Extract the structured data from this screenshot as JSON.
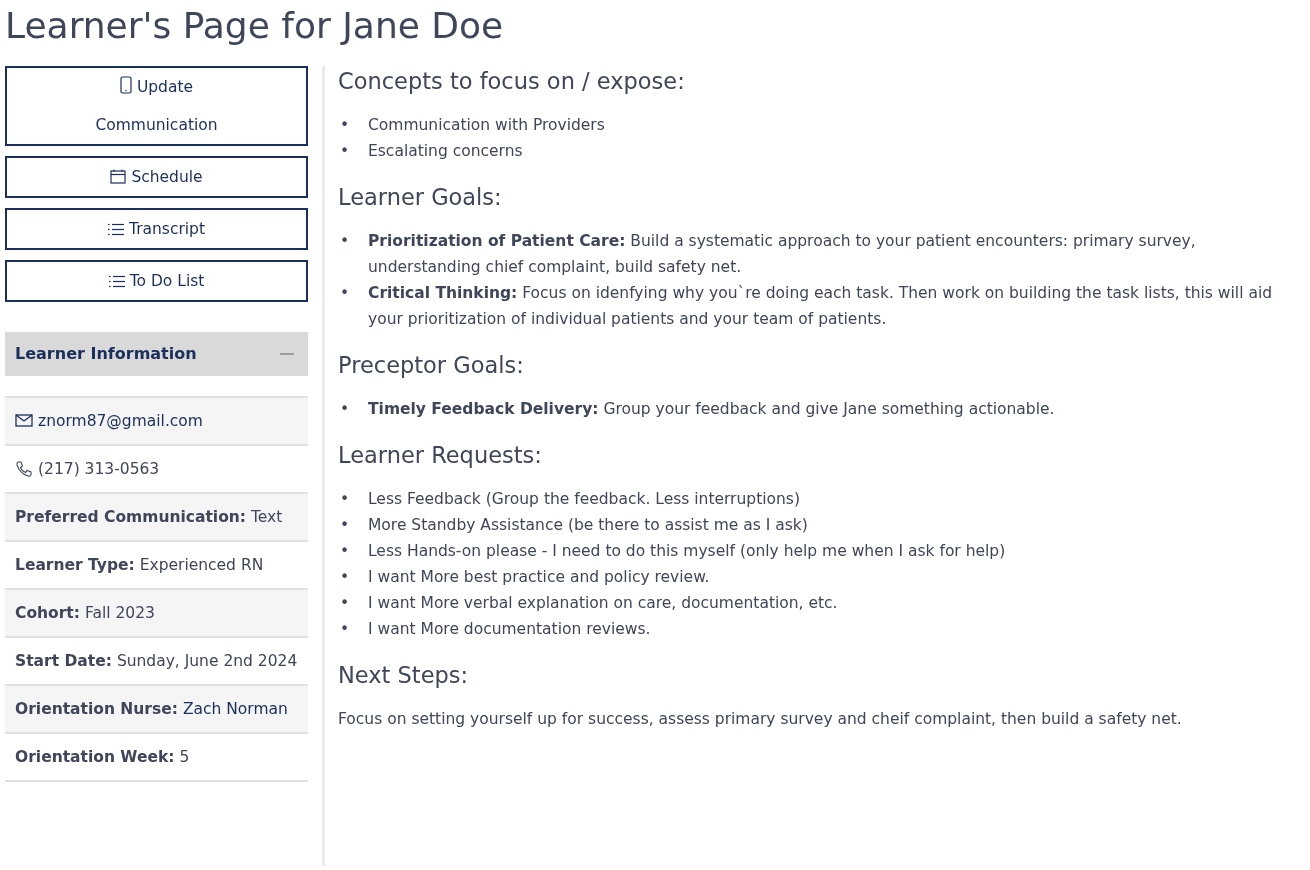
{
  "title": "Learner's Page for Jane Doe",
  "buttons": [
    {
      "label": "Update Communication",
      "kind": "phone"
    },
    {
      "label": "Schedule",
      "kind": "calendar"
    },
    {
      "label": "Transcript",
      "kind": "list"
    },
    {
      "label": "To Do List",
      "kind": "list"
    }
  ],
  "learner_info": {
    "title": "Learner Information",
    "expanded": true,
    "rows": [
      {
        "kind": "email",
        "value": "znorm87@gmail.com"
      },
      {
        "kind": "phone",
        "value": "(217) 313-0563"
      },
      {
        "kind": "field",
        "label": "Preferred Communication:",
        "value": "Text",
        "link": false
      },
      {
        "kind": "field",
        "label": "Learner Type:",
        "value": "Experienced RN",
        "link": false
      },
      {
        "kind": "field",
        "label": "Cohort:",
        "value": "Fall 2023",
        "link": false
      },
      {
        "kind": "field",
        "label": "Start Date:",
        "value": "Sunday, June 2nd 2024",
        "link": false
      },
      {
        "kind": "field",
        "label": "Orientation Nurse:",
        "value": "Zach Norman",
        "link": true
      },
      {
        "kind": "field",
        "label": "Orientation Week:",
        "value": "5",
        "link": false
      }
    ]
  },
  "marker": "•",
  "sections": [
    {
      "heading": "Concepts to focus on / expose:",
      "kind": "bullets",
      "items": [
        "Communication with Providers",
        "Escalating concerns"
      ]
    },
    {
      "heading": "Learner Goals:",
      "kind": "bullets",
      "items": [
        "**Prioritization of Patient Care:** Build a systematic approach to your patient encounters: primary survey, understanding chief complaint, build safety net.",
        "**Critical Thinking:** Focus on idenfying why you`re doing each task. Then work on building the task lists, this will aid your prioritization of individual patients and your team of patients."
      ]
    },
    {
      "heading": "Preceptor Goals:",
      "kind": "bullets",
      "items": [
        "**Timely Feedback Delivery:** Group your feedback and give Jane something actionable."
      ]
    },
    {
      "heading": "Learner Requests:",
      "kind": "bullets",
      "items": [
        "Less Feedback (Group the feedback. Less interruptions)",
        "More Standby Assistance (be there to assist me as I ask)",
        "Less Hands-on please - I need to do this myself (only help me when I ask for help)",
        "I want More best practice and policy review.",
        "I want More verbal explanation on care, documentation, etc.",
        "I want More documentation reviews."
      ]
    },
    {
      "heading": "Next Steps:",
      "kind": "paragraph",
      "items": [
        "Focus on setting yourself up for success, assess primary survey and cheif complaint, then build a safety net."
      ]
    }
  ]
}
